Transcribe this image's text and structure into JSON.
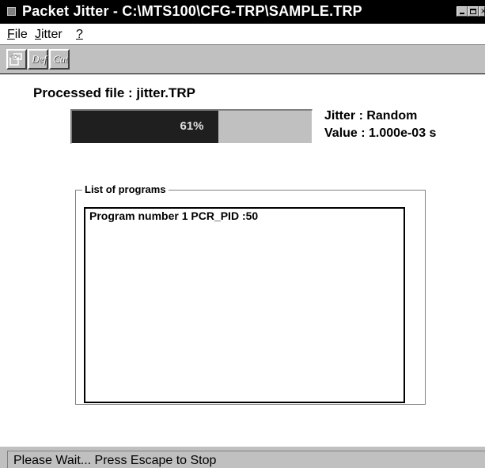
{
  "window": {
    "title": "Packet Jitter - C:\\MTS100\\CFG-TRP\\SAMPLE.TRP"
  },
  "menu": {
    "file": {
      "accel": "F",
      "rest": "ile"
    },
    "jitter": {
      "accel": "J",
      "rest": "itter"
    },
    "help": {
      "accel": "?",
      "rest": ""
    }
  },
  "toolbar": {
    "export_icon": "export-icon",
    "def_label": "Def",
    "cut_label": "Cut"
  },
  "main": {
    "processed_label": "Processed file : jitter.TRP",
    "progress": {
      "percent": 61,
      "label": "61%"
    },
    "jitter_type": "Jitter : Random",
    "jitter_value": "Value : 1.000e-03 s",
    "programs_group_label": "List of programs",
    "programs": [
      "Program number 1 PCR_PID :50"
    ]
  },
  "status": {
    "text": "Please Wait... Press Escape to Stop"
  },
  "colors": {
    "titlebar": "#000000",
    "face": "#c0c0c0",
    "progress_fill": "#1f1f1f"
  }
}
